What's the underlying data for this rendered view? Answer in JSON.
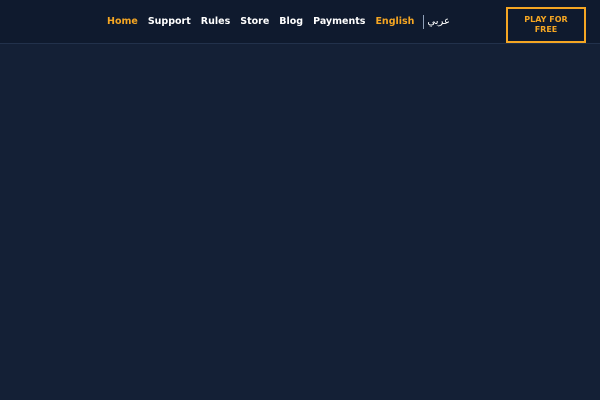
{
  "header": {
    "nav": [
      {
        "label": "Home",
        "active": true
      },
      {
        "label": "Support",
        "active": false
      },
      {
        "label": "Rules",
        "active": false
      },
      {
        "label": "Store",
        "active": false
      },
      {
        "label": "Blog",
        "active": false
      },
      {
        "label": "Payments",
        "active": false
      },
      {
        "label": "English",
        "active": true
      }
    ],
    "language_alt": "عربي",
    "cta_label": "PLAY FOR FREE"
  },
  "colors": {
    "background": "#142036",
    "header_background": "#0f1a2e",
    "accent": "#f5a623",
    "text": "#ffffff"
  }
}
